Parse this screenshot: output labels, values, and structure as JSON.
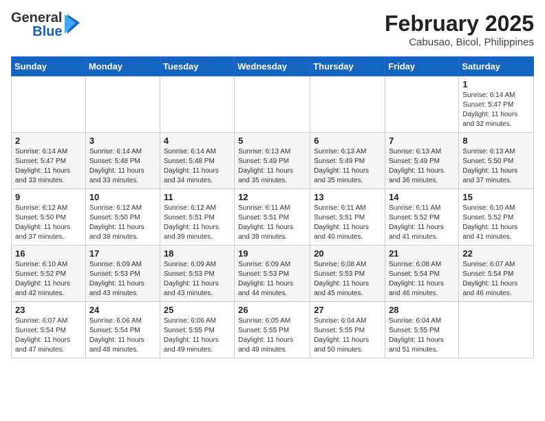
{
  "logo": {
    "general": "General",
    "blue": "Blue"
  },
  "header": {
    "month": "February 2025",
    "location": "Cabusao, Bicol, Philippines"
  },
  "weekdays": [
    "Sunday",
    "Monday",
    "Tuesday",
    "Wednesday",
    "Thursday",
    "Friday",
    "Saturday"
  ],
  "weeks": [
    [
      {
        "day": "",
        "info": ""
      },
      {
        "day": "",
        "info": ""
      },
      {
        "day": "",
        "info": ""
      },
      {
        "day": "",
        "info": ""
      },
      {
        "day": "",
        "info": ""
      },
      {
        "day": "",
        "info": ""
      },
      {
        "day": "1",
        "info": "Sunrise: 6:14 AM\nSunset: 5:47 PM\nDaylight: 11 hours and 32 minutes."
      }
    ],
    [
      {
        "day": "2",
        "info": "Sunrise: 6:14 AM\nSunset: 5:47 PM\nDaylight: 11 hours and 33 minutes."
      },
      {
        "day": "3",
        "info": "Sunrise: 6:14 AM\nSunset: 5:48 PM\nDaylight: 11 hours and 33 minutes."
      },
      {
        "day": "4",
        "info": "Sunrise: 6:14 AM\nSunset: 5:48 PM\nDaylight: 11 hours and 34 minutes."
      },
      {
        "day": "5",
        "info": "Sunrise: 6:13 AM\nSunset: 5:49 PM\nDaylight: 11 hours and 35 minutes."
      },
      {
        "day": "6",
        "info": "Sunrise: 6:13 AM\nSunset: 5:49 PM\nDaylight: 11 hours and 35 minutes."
      },
      {
        "day": "7",
        "info": "Sunrise: 6:13 AM\nSunset: 5:49 PM\nDaylight: 11 hours and 36 minutes."
      },
      {
        "day": "8",
        "info": "Sunrise: 6:13 AM\nSunset: 5:50 PM\nDaylight: 11 hours and 37 minutes."
      }
    ],
    [
      {
        "day": "9",
        "info": "Sunrise: 6:12 AM\nSunset: 5:50 PM\nDaylight: 11 hours and 37 minutes."
      },
      {
        "day": "10",
        "info": "Sunrise: 6:12 AM\nSunset: 5:50 PM\nDaylight: 11 hours and 38 minutes."
      },
      {
        "day": "11",
        "info": "Sunrise: 6:12 AM\nSunset: 5:51 PM\nDaylight: 11 hours and 39 minutes."
      },
      {
        "day": "12",
        "info": "Sunrise: 6:11 AM\nSunset: 5:51 PM\nDaylight: 11 hours and 39 minutes."
      },
      {
        "day": "13",
        "info": "Sunrise: 6:11 AM\nSunset: 5:51 PM\nDaylight: 11 hours and 40 minutes."
      },
      {
        "day": "14",
        "info": "Sunrise: 6:11 AM\nSunset: 5:52 PM\nDaylight: 11 hours and 41 minutes."
      },
      {
        "day": "15",
        "info": "Sunrise: 6:10 AM\nSunset: 5:52 PM\nDaylight: 11 hours and 41 minutes."
      }
    ],
    [
      {
        "day": "16",
        "info": "Sunrise: 6:10 AM\nSunset: 5:52 PM\nDaylight: 11 hours and 42 minutes."
      },
      {
        "day": "17",
        "info": "Sunrise: 6:09 AM\nSunset: 5:53 PM\nDaylight: 11 hours and 43 minutes."
      },
      {
        "day": "18",
        "info": "Sunrise: 6:09 AM\nSunset: 5:53 PM\nDaylight: 11 hours and 43 minutes."
      },
      {
        "day": "19",
        "info": "Sunrise: 6:09 AM\nSunset: 5:53 PM\nDaylight: 11 hours and 44 minutes."
      },
      {
        "day": "20",
        "info": "Sunrise: 6:08 AM\nSunset: 5:53 PM\nDaylight: 11 hours and 45 minutes."
      },
      {
        "day": "21",
        "info": "Sunrise: 6:08 AM\nSunset: 5:54 PM\nDaylight: 11 hours and 46 minutes."
      },
      {
        "day": "22",
        "info": "Sunrise: 6:07 AM\nSunset: 5:54 PM\nDaylight: 11 hours and 46 minutes."
      }
    ],
    [
      {
        "day": "23",
        "info": "Sunrise: 6:07 AM\nSunset: 5:54 PM\nDaylight: 11 hours and 47 minutes."
      },
      {
        "day": "24",
        "info": "Sunrise: 6:06 AM\nSunset: 5:54 PM\nDaylight: 11 hours and 48 minutes."
      },
      {
        "day": "25",
        "info": "Sunrise: 6:06 AM\nSunset: 5:55 PM\nDaylight: 11 hours and 49 minutes."
      },
      {
        "day": "26",
        "info": "Sunrise: 6:05 AM\nSunset: 5:55 PM\nDaylight: 11 hours and 49 minutes."
      },
      {
        "day": "27",
        "info": "Sunrise: 6:04 AM\nSunset: 5:55 PM\nDaylight: 11 hours and 50 minutes."
      },
      {
        "day": "28",
        "info": "Sunrise: 6:04 AM\nSunset: 5:55 PM\nDaylight: 11 hours and 51 minutes."
      },
      {
        "day": "",
        "info": ""
      }
    ]
  ]
}
